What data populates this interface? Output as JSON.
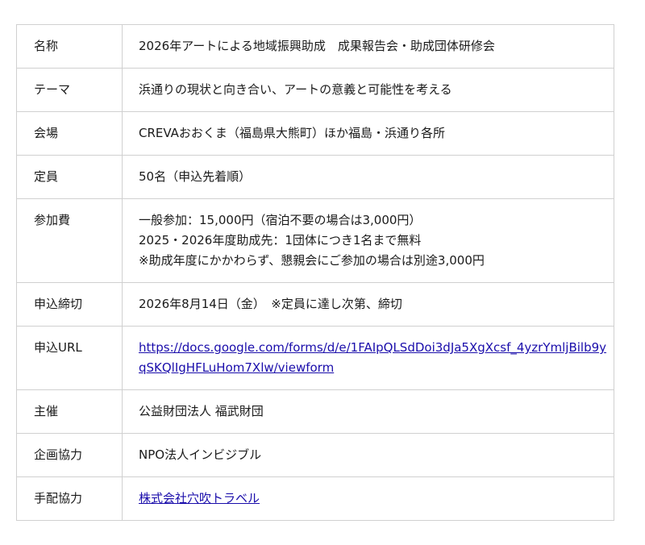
{
  "rows": [
    {
      "label": "名称",
      "value": "2026年アートによる地域振興助成　成果報告会・助成団体研修会"
    },
    {
      "label": "テーマ",
      "value": "浜通りの現状と向き合い、アートの意義と可能性を考える"
    },
    {
      "label": "会場",
      "value": "CREVAおおくま（福島県大熊町）ほか福島・浜通り各所"
    },
    {
      "label": "定員",
      "value": "50名（申込先着順）"
    },
    {
      "label": "参加費",
      "lines": [
        "一般参加：15,000円（宿泊不要の場合は3,000円）",
        "2025・2026年度助成先：1団体につき1名まで無料",
        "※助成年度にかかわらず、懇親会にご参加の場合は別途3,000円"
      ]
    },
    {
      "label": "申込締切",
      "value": "2026年8月14日（金）　※定員に達し次第、締切"
    },
    {
      "label": "申込URL",
      "link": "https://docs.google.com/forms/d/e/1FAIpQLSdDoi3dJa5XgXcsf_4yzrYmljBilb9yqSKQlIgHFLuHom7Xlw/viewform"
    },
    {
      "label": "主催",
      "value": "公益財団法人 福武財団"
    },
    {
      "label": "企画協力",
      "value": "NPO法人インビジブル"
    },
    {
      "label": "手配協力",
      "link": "株式会社穴吹トラベル"
    }
  ]
}
